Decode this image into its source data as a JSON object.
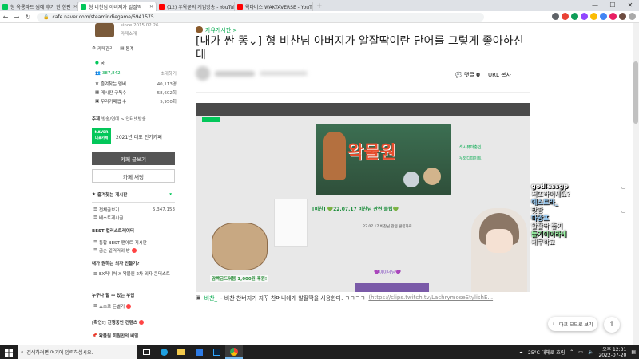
{
  "tabs": [
    {
      "label": "형 옥룡파트 썸에 후기 한 한판",
      "color": "#03c75a"
    },
    {
      "label": "형 비찬님 아버지가 알잘딱",
      "color": "#03c75a"
    },
    {
      "label": "(12) 우왁굳의 게임방송 - YouTub",
      "color": "#ff0000"
    },
    {
      "label": "왁타버스 WAKTAVERSE - YouTub",
      "color": "#ff0000"
    }
  ],
  "window": {
    "minimize": "—",
    "maximize": "☐",
    "close": "✕"
  },
  "address": {
    "url": "cafe.naver.com/steamindiegame/6941575"
  },
  "sidebar": {
    "since": "since 2015.02.26.",
    "intro": "카페소개",
    "manage": "카페관리",
    "stats": "통계",
    "grade": "굼",
    "members": "387,842",
    "invite": "초대하기",
    "fav_label": "즐겨찾는 멤버",
    "fav_value": "40,113명",
    "board_sub_label": "게시판 구독수",
    "board_sub_value": "58,602회",
    "cafe_sub_label": "우리카페앱 수",
    "cafe_sub_value": "5,950회",
    "topic_label": "주제",
    "topic_value": "방송/연예 > 인터넷방송",
    "badge_top": "NAVER",
    "badge_bottom": "대표카페",
    "badge_text": "2021년 대표 인기카페",
    "write_btn": "카페 글쓰기",
    "chat_btn": "카페 채팅",
    "fav_boards": "즐겨찾는 게시판",
    "all_posts": "전체글보기",
    "all_posts_count": "5,347,153",
    "best_posts": "베스트게시글",
    "best_template": "BEST 컬러스트레이터",
    "item_best": "통합 BEST 팬아트 게시판",
    "item_game": "굼손 일러러의 방",
    "item_custom": "내가 원하는 의자 만들기?",
    "item_ex": "EX퍼니처 X 왁물원 2차 의자 콘테스트",
    "item_who": "누구나 할 수 있는 부업",
    "item_shorts": "쇼츠로 돈벌기",
    "item_info": "[확인!] 진행중인 컨텐츠",
    "item_secret": "왁물원 회원만의 비밀"
  },
  "post": {
    "category": "자유게시판 >",
    "title": "[내가 싼 똥⌄] 형 비찬님 아버지가 알잘딱이란 단어를 그렇게 좋아하신데",
    "comment_label": "댓글",
    "comment_count": "0",
    "url_copy": "URL 복사",
    "more": "⋮"
  },
  "video": {
    "banner": "왁물원",
    "post_title": "[비찬] 💚22.07.17 비찬님 관련 클립💚",
    "subline": "22.07.17 비찬님 관련 클립자료",
    "heart_line": "💜아이네님💜",
    "subtitle": "감빡금드워봄 1,000원 후원!",
    "side1": "섹시퓨마충인",
    "side2": "우와디피이트"
  },
  "caption": {
    "author": "비찬_",
    "text": " - 비찬 찬버지가 자꾸 찬머니에게 알잘딱을 사용한다. ㅋㅋㅋㅋ",
    "link": "(https://clips.twitch.tv/LachrymoseStylishE..."
  },
  "chat": [
    {
      "user": "godlessgp",
      "msg": "저또하이세요?",
      "color": "#ffffff"
    },
    {
      "user": "에스트라_",
      "msg": "맞팡",
      "color": "#9fd4ff"
    },
    {
      "user": "마왕프",
      "msg": "알잘딱 좋기",
      "color": "#9fd4ff"
    },
    {
      "user": "둘기이이라네",
      "msg": "제쿠학교",
      "color": "#9fffa9"
    }
  ],
  "buttons": {
    "dark_mode": "다크 모드로 보기",
    "top": "↑"
  },
  "taskbar": {
    "search_placeholder": "검색하려면 여기에 입력하십시오.",
    "weather": "25°C 대체로 흐림",
    "time": "오후 12:31",
    "date": "2022-07-20"
  }
}
